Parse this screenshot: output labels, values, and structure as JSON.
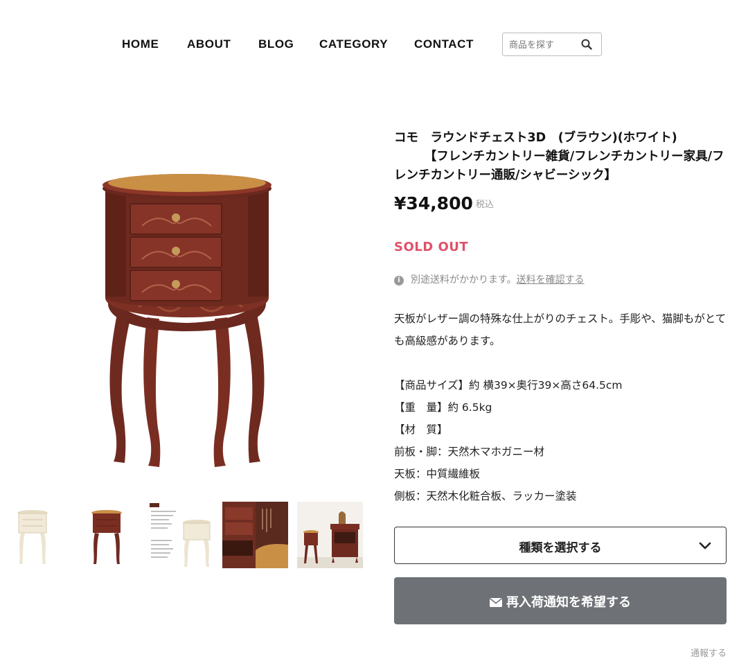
{
  "nav": {
    "items": [
      "HOME",
      "ABOUT",
      "BLOG",
      "CATEGORY",
      "CONTACT"
    ],
    "search_placeholder": "商品を探す"
  },
  "product": {
    "title": "コモ　ラウンドチェスト3D　(ブラウン)(ホワイト)\n　　　【フレンチカントリー雑貨/フレンチカントリー家具/フレンチカントリー通販/シャビーシック】",
    "price": "¥34,800",
    "tax_label": "税込",
    "status": "SOLD OUT",
    "shipping_text": "別途送料がかかります。",
    "shipping_link": "送料を確認する",
    "description": [
      "天板がレザー調の特殊な仕上がりのチェスト。手彫や、猫脚もがとても高級感があります。",
      "",
      "【商品サイズ】約 横39×奥行39×高さ64.5cm",
      "【重　量】約 6.5kg",
      "【材　質】",
      "前板・脚：天然木マホガニー材",
      "天板：中質繊維板",
      "側板：天然木化粧合板、ラッカー塗装"
    ],
    "variant_select_label": "種類を選択する",
    "notify_button_label": "再入荷通知を希望する",
    "report_link": "通報する"
  },
  "colors": {
    "soldout": "#e0506a",
    "button_gray": "#6e7176",
    "wood_brown": "#7a2e22",
    "top_leather": "#c98f45",
    "white_finish": "#f1ead8"
  },
  "thumbnails": [
    {
      "icon": "white-chest-thumbnail"
    },
    {
      "icon": "brown-chest-thumbnail"
    },
    {
      "icon": "spec-sheet-thumbnail"
    },
    {
      "icon": "detail-drawer-thumbnail"
    },
    {
      "icon": "room-scene-thumbnail"
    }
  ]
}
